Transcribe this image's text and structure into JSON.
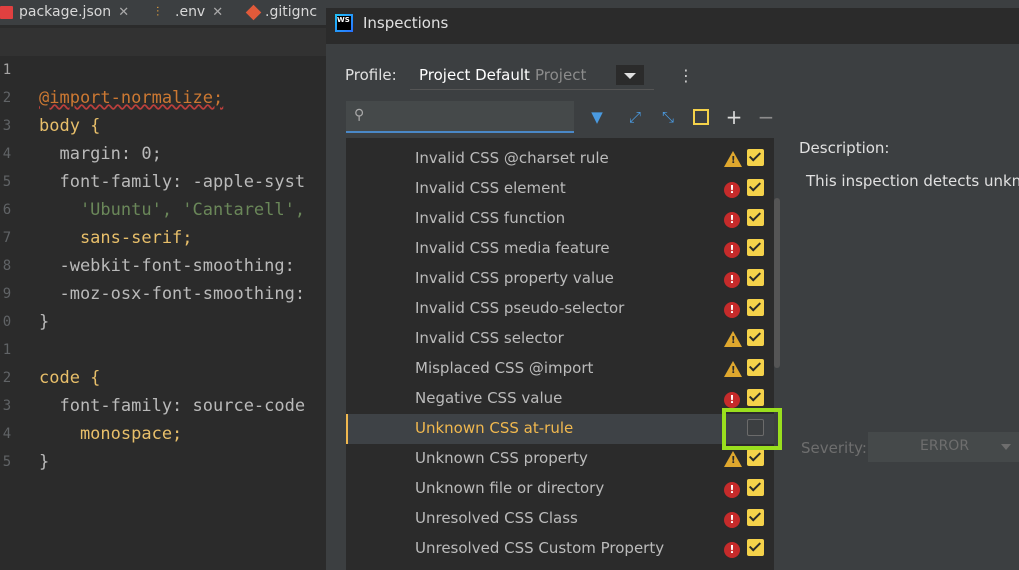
{
  "editor_tabs": [
    {
      "name": "package.json",
      "icon": "json-file-icon"
    },
    {
      "name": ".env",
      "icon": "env-file-icon"
    },
    {
      "name": ".gitignc",
      "icon": "git-file-icon"
    }
  ],
  "code_lines": [
    {
      "num": "1",
      "text": "@import-normalize;"
    },
    {
      "num": "2",
      "text": "body {"
    },
    {
      "num": "3",
      "text": "  margin: 0;"
    },
    {
      "num": "4",
      "text": "  font-family: -apple-syst"
    },
    {
      "num": "5",
      "text": "    'Ubuntu', 'Cantarell',"
    },
    {
      "num": "6",
      "text": "    sans-serif;"
    },
    {
      "num": "7",
      "text": "  -webkit-font-smoothing:"
    },
    {
      "num": "8",
      "text": "  -moz-osx-font-smoothing:"
    },
    {
      "num": "9",
      "text": "}"
    },
    {
      "num": "0",
      "text": ""
    },
    {
      "num": "1",
      "text": "code {"
    },
    {
      "num": "2",
      "text": "  font-family: source-code"
    },
    {
      "num": "3",
      "text": "    monospace;"
    },
    {
      "num": "4",
      "text": "}"
    },
    {
      "num": "5",
      "text": ""
    }
  ],
  "dialog": {
    "title": "Inspections",
    "profile_label": "Profile:",
    "profile_value": "Project Default",
    "profile_scope": "Project",
    "more_icon": "⋮"
  },
  "toolbar": [
    {
      "name": "filter-icon",
      "glyph": "▼"
    },
    {
      "name": "expand-all-icon",
      "glyph": "⤢"
    },
    {
      "name": "collapse-all-icon",
      "glyph": "⤡"
    },
    {
      "name": "reset-icon",
      "glyph": "□"
    },
    {
      "name": "add-icon",
      "glyph": "+"
    },
    {
      "name": "remove-icon",
      "glyph": "−"
    }
  ],
  "inspections": [
    {
      "label": "Invalid CSS @charset rule",
      "severity": "warning",
      "enabled": true
    },
    {
      "label": "Invalid CSS element",
      "severity": "error",
      "enabled": true
    },
    {
      "label": "Invalid CSS function",
      "severity": "error",
      "enabled": true
    },
    {
      "label": "Invalid CSS media feature",
      "severity": "error",
      "enabled": true
    },
    {
      "label": "Invalid CSS property value",
      "severity": "error",
      "enabled": true
    },
    {
      "label": "Invalid CSS pseudo-selector",
      "severity": "error",
      "enabled": true
    },
    {
      "label": "Invalid CSS selector",
      "severity": "warning",
      "enabled": true
    },
    {
      "label": "Misplaced CSS @import",
      "severity": "warning",
      "enabled": true
    },
    {
      "label": "Negative CSS value",
      "severity": "error",
      "enabled": true
    },
    {
      "label": "Unknown CSS at-rule",
      "severity": "none",
      "enabled": false,
      "selected": true
    },
    {
      "label": "Unknown CSS property",
      "severity": "warning",
      "enabled": true
    },
    {
      "label": "Unknown file or directory",
      "severity": "error",
      "enabled": true
    },
    {
      "label": "Unresolved CSS Class",
      "severity": "error",
      "enabled": true
    },
    {
      "label": "Unresolved CSS Custom Property",
      "severity": "error",
      "enabled": true
    }
  ],
  "details": {
    "description_label": "Description:",
    "description_text": "This inspection detects unkno",
    "severity_label": "Severity:",
    "severity_value": "ERROR"
  },
  "colors": {
    "accent": "#f0b84f",
    "checkbox": "#f5d24a",
    "error": "#c52b2b",
    "warning": "#e0a82e",
    "highlight_box": "#9adf1e"
  }
}
